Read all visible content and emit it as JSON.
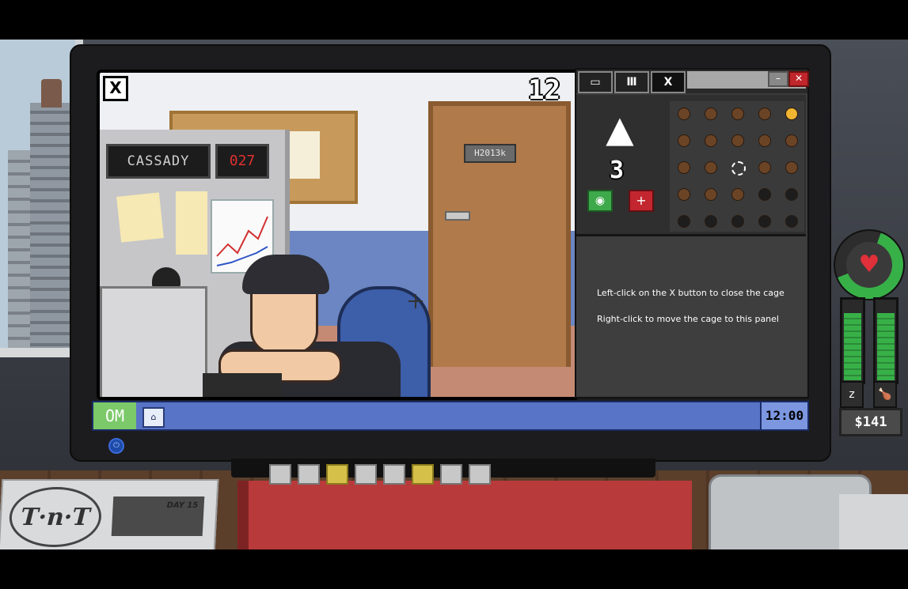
{
  "camera": {
    "close_label": "X",
    "number": "12",
    "name_display": "CASSADY",
    "code_display": "027",
    "door_plate": "H2013k"
  },
  "panel": {
    "tabs": [
      "▭",
      "Ⅲ",
      "X"
    ],
    "minimize_label": "–",
    "close_label": "✕",
    "emblem_icon": "▲",
    "level": "3",
    "eye_label": "◉",
    "plus_label": "+",
    "instructions": [
      "Left-click on the X button to close the cage",
      "Right-click to move the cage to this panel"
    ]
  },
  "taskbar": {
    "os_label": "OM",
    "app_icon": "⌂",
    "clock": "12:00"
  },
  "stats": {
    "heart_icon": "♥",
    "sleep_icon": "z",
    "food_icon": "🍗",
    "money": "$141",
    "health_level": 0.8,
    "sleep_level": 0.85,
    "food_level": 0.85
  },
  "desk": {
    "newspaper_logo": "T·n·T",
    "newspaper_day": "DAY 15"
  },
  "colors": {
    "accent_green": "#38b048",
    "alert_red": "#c3262e",
    "taskbar_blue": "#5874c6"
  }
}
